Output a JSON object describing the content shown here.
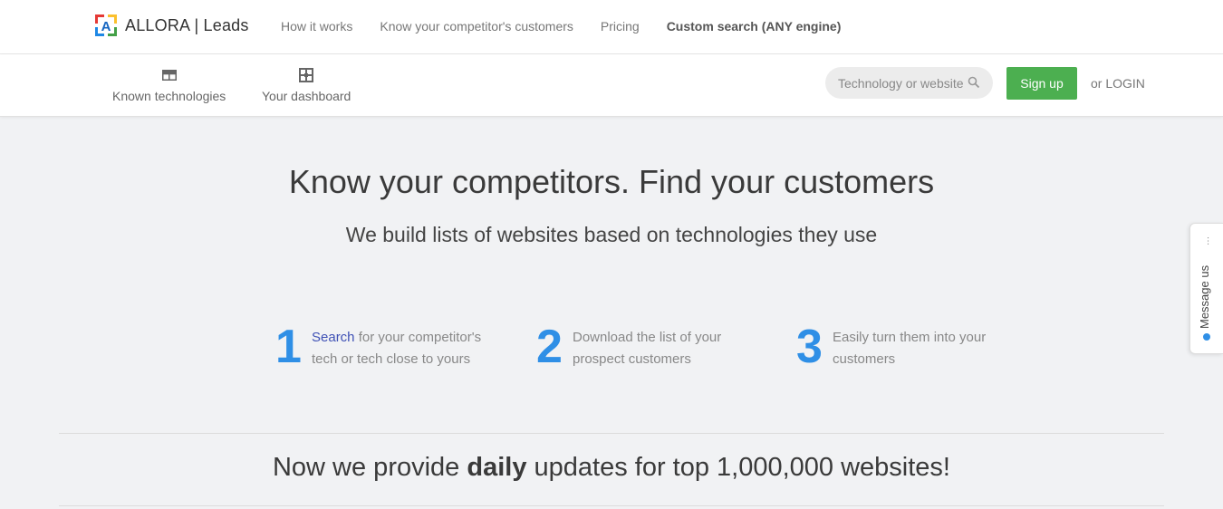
{
  "header": {
    "brand": "ALLORA | Leads",
    "nav": [
      {
        "label": "How it works"
      },
      {
        "label": "Know your competitor's customers"
      },
      {
        "label": "Pricing"
      },
      {
        "label": "Custom search (ANY engine)"
      }
    ]
  },
  "subnav": {
    "items": [
      {
        "label": "Known technologies",
        "icon": "table-icon"
      },
      {
        "label": "Your dashboard",
        "icon": "dashboard-icon"
      }
    ],
    "search": {
      "placeholder": "Technology or website"
    },
    "signup_label": "Sign up",
    "login_label": "or LOGIN"
  },
  "hero": {
    "title": "Know your competitors. Find your customers",
    "subtitle": "We build lists of websites based on technologies they use"
  },
  "steps": [
    {
      "number": "1",
      "link_text": "Search",
      "text": " for your competitor's tech or tech close to yours"
    },
    {
      "number": "2",
      "text": "Download the list of your prospect customers"
    },
    {
      "number": "3",
      "text": "Easily turn them into your customers"
    }
  ],
  "banner": {
    "prefix": "Now we provide ",
    "bold": "daily",
    "suffix": " updates for top 1,000,000 websites!"
  },
  "message_tab": {
    "label": "Message us",
    "dots": "···"
  },
  "colors": {
    "accent_blue": "#2f8fe6",
    "signup_green": "#4caf50",
    "link_indigo": "#3f51b5",
    "background": "#f1f2f4"
  }
}
